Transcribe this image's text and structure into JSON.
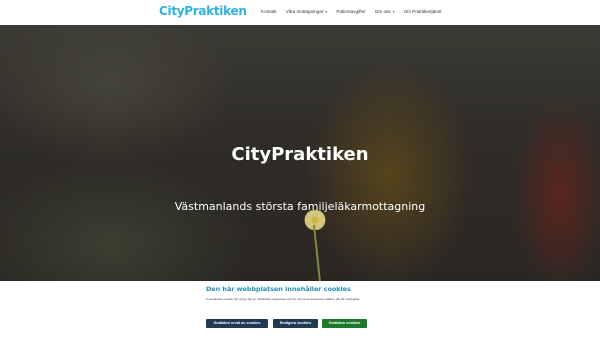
{
  "header": {
    "logo": {
      "part1": "City",
      "part2": "Praktiken"
    },
    "nav": [
      {
        "label": "Kontakt",
        "has_dropdown": false
      },
      {
        "label": "Våra mottagningar",
        "has_dropdown": true
      },
      {
        "label": "Patientavgifter",
        "has_dropdown": false
      },
      {
        "label": "Om oss",
        "has_dropdown": true
      },
      {
        "label": "Om Praktikertjänst",
        "has_dropdown": false
      }
    ]
  },
  "hero": {
    "title": "CityPraktiken",
    "subtitle": "Västmanlands största familjeläkarmottagning"
  },
  "cookie_banner": {
    "title": "Den här webbplatsen innehåller cookies",
    "text": "Vi använder cookies för att ge dig en förbättrad upplevelse och för att kunna analysera trafiken på vår webbplats.",
    "buttons": {
      "accept_selection": "Godkänn urval av cookies",
      "edit": "Redigera cookies",
      "accept_all": "Godkänn cookies"
    }
  },
  "colors": {
    "brand": "#2bb3e0",
    "cookie_title": "#1e8eb6",
    "button_dark": "#1f3a52",
    "button_green": "#1a7a2a"
  }
}
